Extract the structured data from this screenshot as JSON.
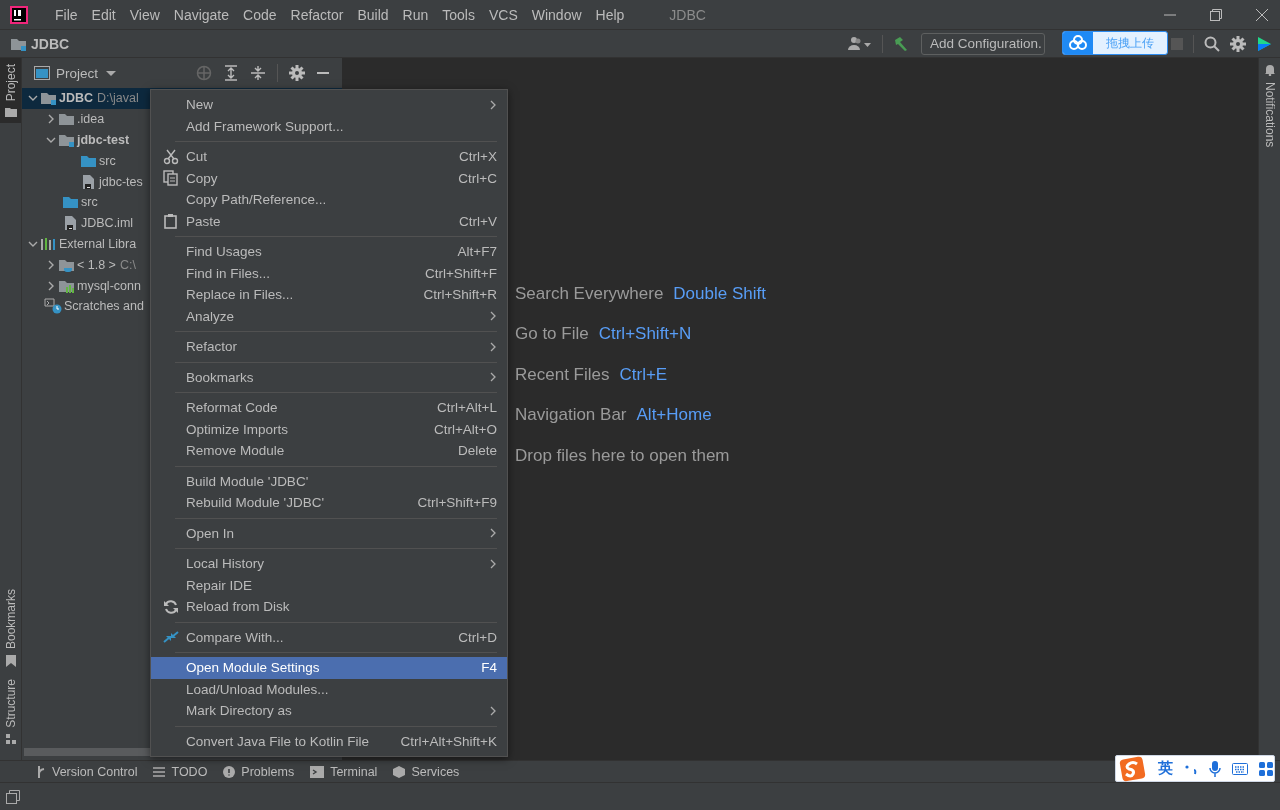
{
  "window": {
    "title": "JDBC"
  },
  "menu_bar": [
    "File",
    "Edit",
    "View",
    "Navigate",
    "Code",
    "Refactor",
    "Build",
    "Run",
    "Tools",
    "VCS",
    "Window",
    "Help"
  ],
  "navigation_bar": {
    "breadcrumb": "JDBC",
    "run_configuration": "Add Configuration."
  },
  "upload_overlay": {
    "label": "拖拽上传"
  },
  "left_stripe_top": [
    {
      "label": "Project",
      "selected": true
    }
  ],
  "left_stripe_bottom": [
    {
      "label": "Bookmarks",
      "selected": false
    },
    {
      "label": "Structure",
      "selected": false
    }
  ],
  "right_stripe": [
    {
      "label": "Notifications",
      "selected": false
    }
  ],
  "project_panel": {
    "title": "Project",
    "tree": [
      {
        "kind": "module",
        "name": "JDBC",
        "path": "D:\\javal",
        "selected": true,
        "expanded": true,
        "children": [
          {
            "kind": "folder",
            "name": ".idea",
            "selected": false,
            "expanded": false
          },
          {
            "kind": "module",
            "name": "jdbc-test",
            "selected": false,
            "expanded": true,
            "children": [
              {
                "kind": "source-folder",
                "name": "src",
                "selected": false
              },
              {
                "kind": "file",
                "name": "jdbc-tes",
                "selected": false
              }
            ]
          },
          {
            "kind": "source-folder",
            "name": "src",
            "selected": false
          },
          {
            "kind": "file",
            "name": "JDBC.iml",
            "selected": false
          }
        ]
      },
      {
        "kind": "libraries",
        "name": "External Libra",
        "selected": false,
        "expanded": true,
        "children": [
          {
            "kind": "jdk",
            "name": "< 1.8 >",
            "path": "C:\\",
            "selected": false,
            "expanded": false
          },
          {
            "kind": "library",
            "name": "mysql-conn",
            "selected": false,
            "expanded": false
          }
        ]
      },
      {
        "kind": "scratches",
        "name": "Scratches and",
        "selected": false
      }
    ]
  },
  "context_menu": {
    "items": [
      {
        "kind": "item",
        "label": "New",
        "selected": false,
        "submenu": true
      },
      {
        "kind": "item",
        "label": "Add Framework Support...",
        "selected": false,
        "submenu": false
      },
      {
        "kind": "separator"
      },
      {
        "kind": "item",
        "label": "Cut",
        "shortcut": "Ctrl+X",
        "selected": false,
        "submenu": false
      },
      {
        "kind": "item",
        "label": "Copy",
        "shortcut": "Ctrl+C",
        "selected": false,
        "submenu": false
      },
      {
        "kind": "item",
        "label": "Copy Path/Reference...",
        "selected": false,
        "submenu": false
      },
      {
        "kind": "item",
        "label": "Paste",
        "shortcut": "Ctrl+V",
        "selected": false,
        "submenu": false
      },
      {
        "kind": "separator"
      },
      {
        "kind": "item",
        "label": "Find Usages",
        "shortcut": "Alt+F7",
        "selected": false,
        "submenu": false
      },
      {
        "kind": "item",
        "label": "Find in Files...",
        "shortcut": "Ctrl+Shift+F",
        "selected": false,
        "submenu": false
      },
      {
        "kind": "item",
        "label": "Replace in Files...",
        "shortcut": "Ctrl+Shift+R",
        "selected": false,
        "submenu": false
      },
      {
        "kind": "item",
        "label": "Analyze",
        "selected": false,
        "submenu": true
      },
      {
        "kind": "separator"
      },
      {
        "kind": "item",
        "label": "Refactor",
        "selected": false,
        "submenu": true
      },
      {
        "kind": "separator"
      },
      {
        "kind": "item",
        "label": "Bookmarks",
        "selected": false,
        "submenu": true
      },
      {
        "kind": "separator"
      },
      {
        "kind": "item",
        "label": "Reformat Code",
        "shortcut": "Ctrl+Alt+L",
        "selected": false,
        "submenu": false
      },
      {
        "kind": "item",
        "label": "Optimize Imports",
        "shortcut": "Ctrl+Alt+O",
        "selected": false,
        "submenu": false
      },
      {
        "kind": "item",
        "label": "Remove Module",
        "shortcut": "Delete",
        "selected": false,
        "submenu": false
      },
      {
        "kind": "separator"
      },
      {
        "kind": "item",
        "label": "Build Module 'JDBC'",
        "selected": false,
        "submenu": false
      },
      {
        "kind": "item",
        "label": "Rebuild Module 'JDBC'",
        "shortcut": "Ctrl+Shift+F9",
        "selected": false,
        "submenu": false
      },
      {
        "kind": "separator"
      },
      {
        "kind": "item",
        "label": "Open In",
        "selected": false,
        "submenu": true
      },
      {
        "kind": "separator"
      },
      {
        "kind": "item",
        "label": "Local History",
        "selected": false,
        "submenu": true
      },
      {
        "kind": "item",
        "label": "Repair IDE",
        "selected": false,
        "submenu": false
      },
      {
        "kind": "item",
        "label": "Reload from Disk",
        "selected": false,
        "submenu": false
      },
      {
        "kind": "separator"
      },
      {
        "kind": "item",
        "label": "Compare With...",
        "shortcut": "Ctrl+D",
        "selected": false,
        "submenu": false
      },
      {
        "kind": "separator"
      },
      {
        "kind": "item",
        "label": "Open Module Settings",
        "shortcut": "F4",
        "selected": true,
        "submenu": false
      },
      {
        "kind": "item",
        "label": "Load/Unload Modules...",
        "selected": false,
        "submenu": false
      },
      {
        "kind": "item",
        "label": "Mark Directory as",
        "selected": false,
        "submenu": true
      },
      {
        "kind": "separator"
      },
      {
        "kind": "item",
        "label": "Convert Java File to Kotlin File",
        "shortcut": "Ctrl+Alt+Shift+K",
        "selected": false,
        "submenu": false
      }
    ]
  },
  "editor_hints": [
    {
      "label": "Search Everywhere",
      "shortcut": "Double Shift"
    },
    {
      "label": "Go to File",
      "shortcut": "Ctrl+Shift+N"
    },
    {
      "label": "Recent Files",
      "shortcut": "Ctrl+E"
    },
    {
      "label": "Navigation Bar",
      "shortcut": "Alt+Home"
    },
    {
      "label": "Drop files here to open them"
    }
  ],
  "bottom_tool_tabs": [
    "Version Control",
    "TODO",
    "Problems",
    "Terminal",
    "Services"
  ],
  "ime_toolbar": {
    "language": "英"
  }
}
